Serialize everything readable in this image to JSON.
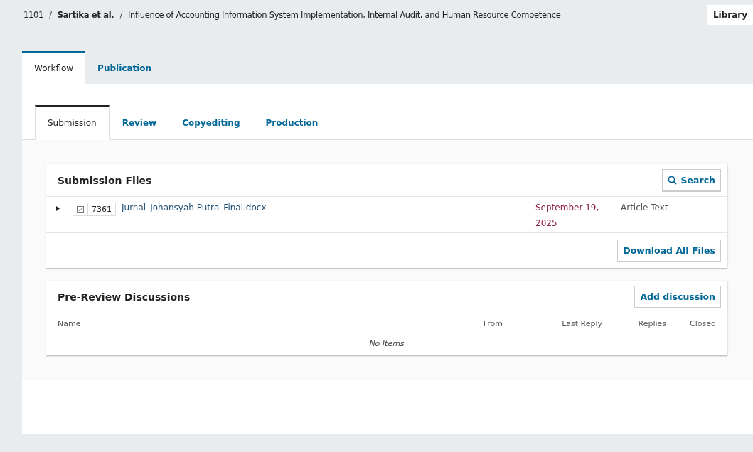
{
  "breadcrumb": {
    "id": "1101",
    "authors": "Sartika et al.",
    "separators": [
      "/",
      "/"
    ],
    "title": "Influence of Accounting Information System Implementation, Internal Audit, and Human Resource Competence"
  },
  "library_button": "Library",
  "tabs": [
    {
      "label": "Workflow",
      "selected": true
    },
    {
      "label": "Publication",
      "selected": false
    }
  ],
  "stage_tabs": [
    {
      "label": "Submission",
      "selected": true
    },
    {
      "label": "Review",
      "selected": false
    },
    {
      "label": "Copyediting",
      "selected": false
    },
    {
      "label": "Production",
      "selected": false
    }
  ],
  "submission_files": {
    "title": "Submission Files",
    "search_button": "Search",
    "files": [
      {
        "expanded": false,
        "id": "7361",
        "name": "Jurnal_Johansyah Putra_Final.docx",
        "date": "September 19, 2025",
        "type": "Article Text"
      }
    ],
    "download_button": "Download All Files"
  },
  "discussions": {
    "title": "Pre-Review Discussions",
    "add_button": "Add discussion",
    "columns": [
      "Name",
      "From",
      "Last Reply",
      "Replies",
      "Closed"
    ],
    "empty_text": "No Items"
  }
}
